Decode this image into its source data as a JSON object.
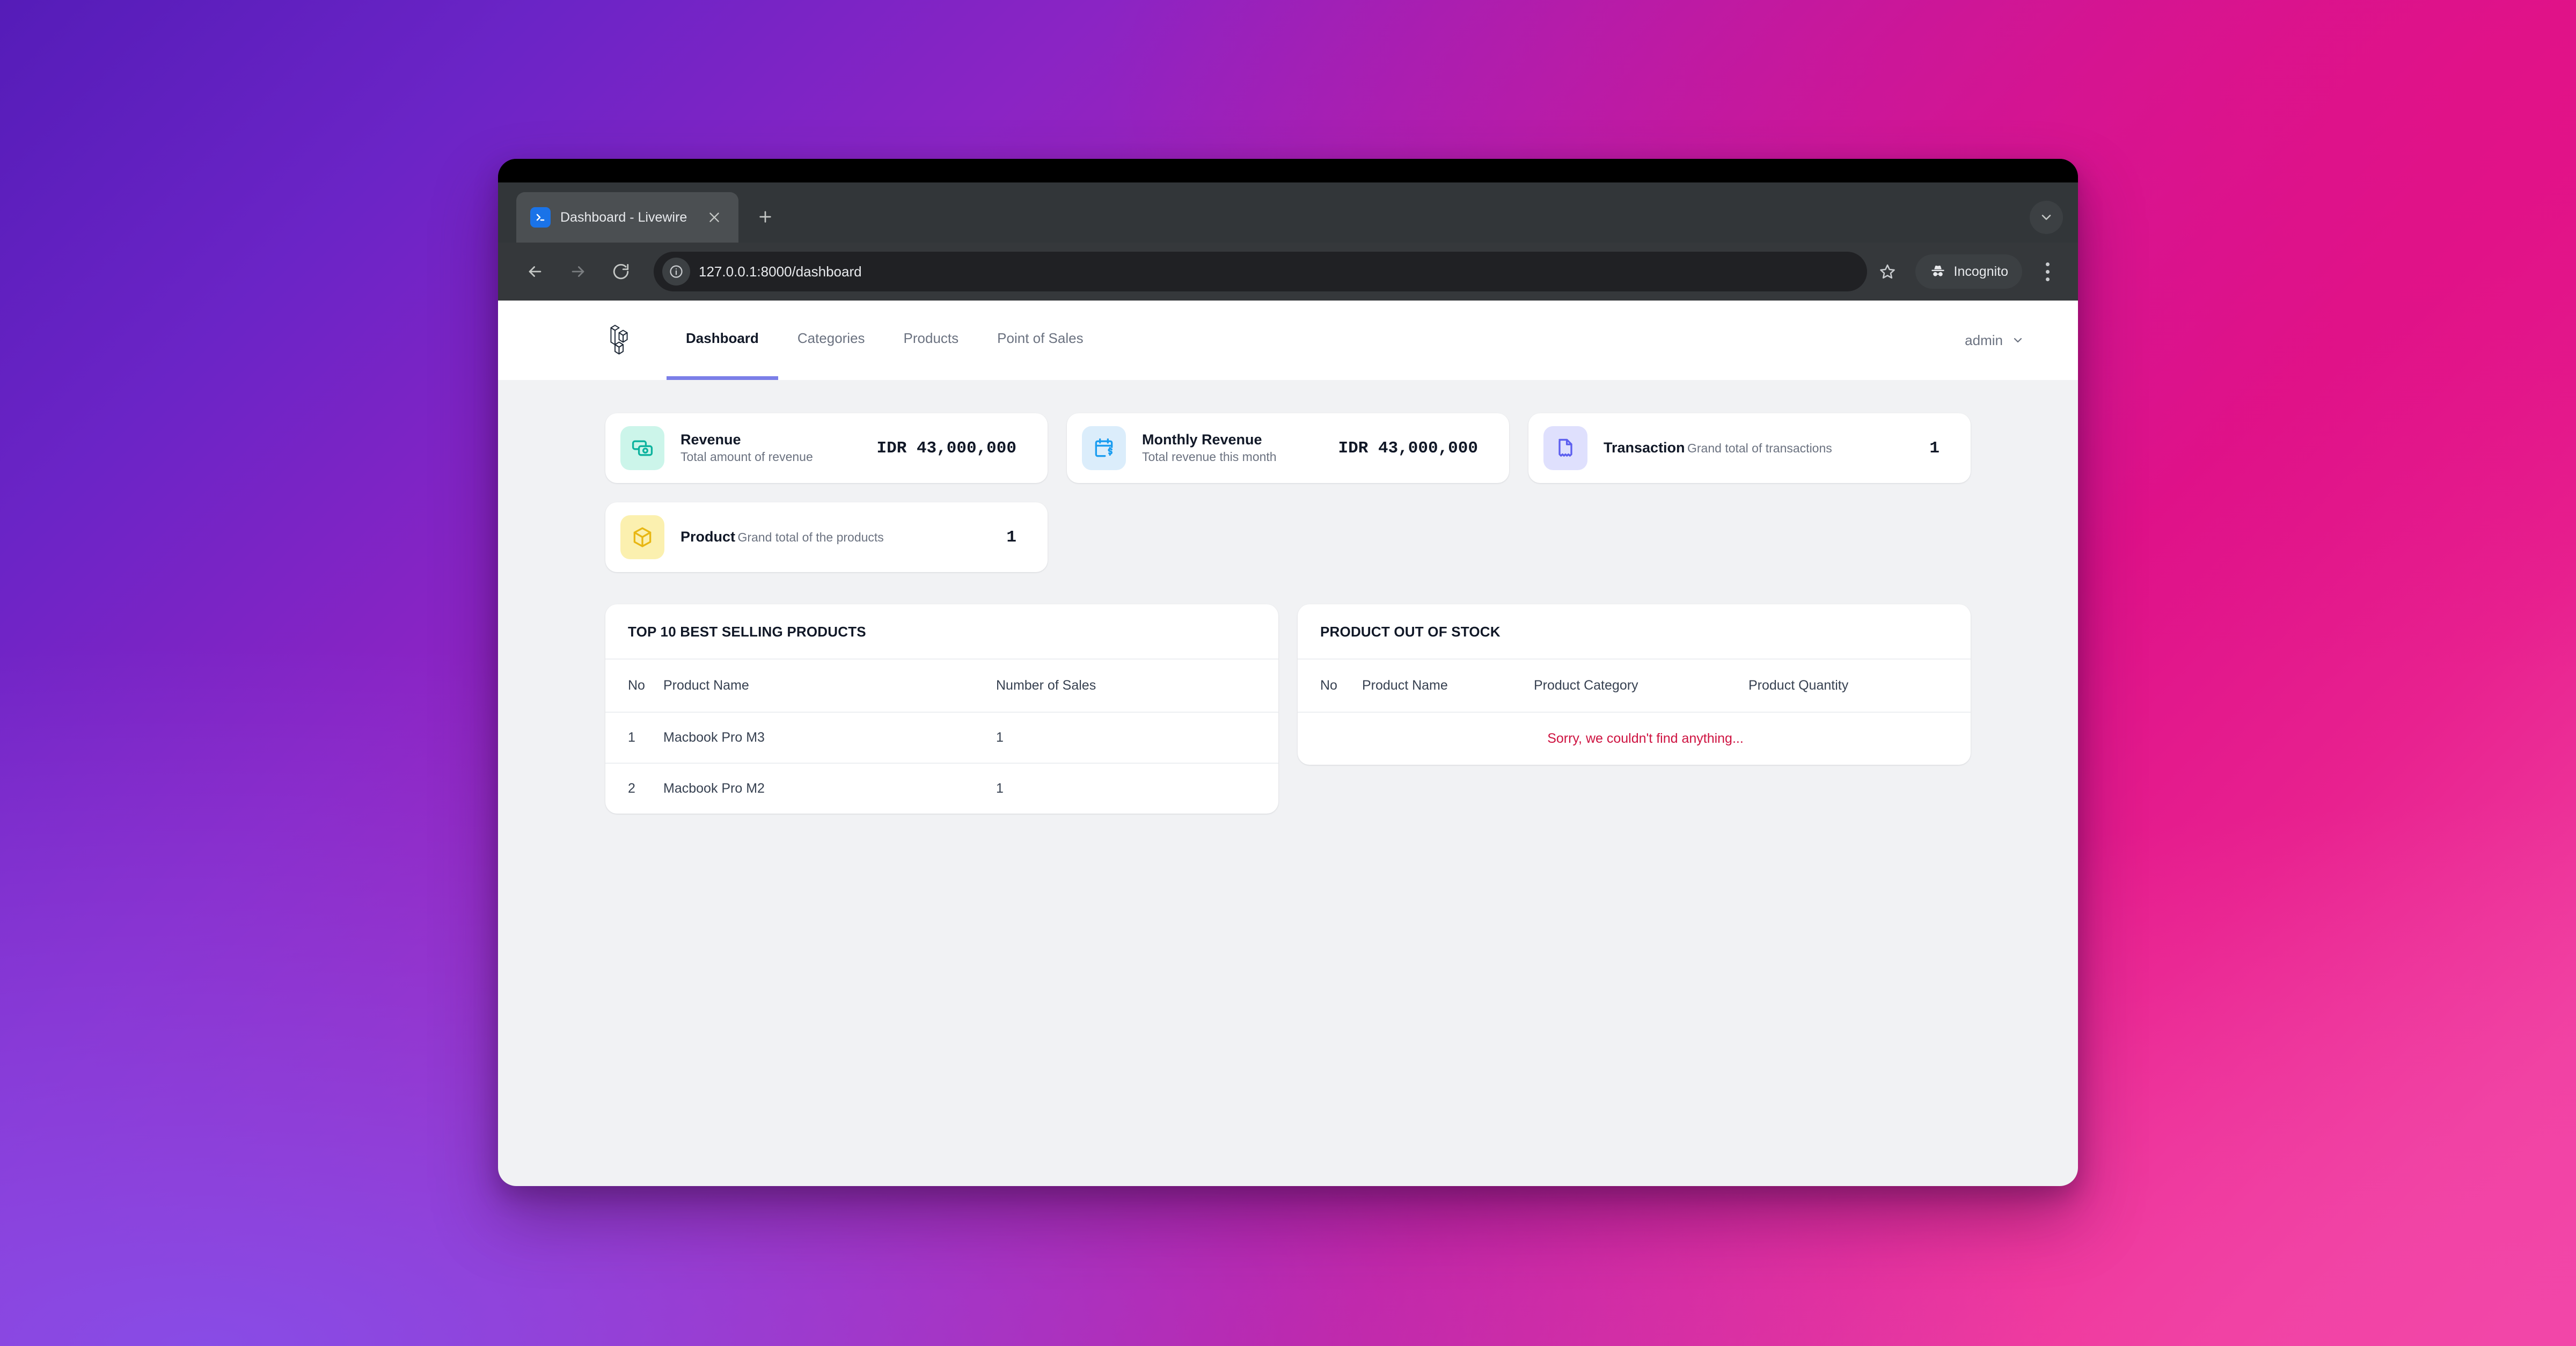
{
  "browser": {
    "tab": {
      "title": "Dashboard - Livewire",
      "favicon_name": "terminal-prompt-icon",
      "close_label": "×"
    },
    "new_tab_label": "+",
    "window_control_name": "tab-search-chevron",
    "toolbar": {
      "back_name": "back-arrow-icon",
      "forward_name": "forward-arrow-icon",
      "reload_name": "reload-icon",
      "site_info_name": "site-info-icon",
      "url": "127.0.0.1:8000/dashboard",
      "bookmark_name": "bookmark-star-icon",
      "incognito_label": "Incognito",
      "incognito_icon_name": "incognito-hat-icon",
      "menu_name": "kebab-menu-icon"
    }
  },
  "app": {
    "brand_name": "laravel-logo",
    "nav_items": [
      {
        "label": "Dashboard",
        "active": true
      },
      {
        "label": "Categories",
        "active": false
      },
      {
        "label": "Products",
        "active": false
      },
      {
        "label": "Point of Sales",
        "active": false
      }
    ],
    "user": {
      "name": "admin",
      "chevron_name": "chevron-down-icon"
    }
  },
  "stats": [
    {
      "title": "Revenue",
      "subtitle": "Total amount of revenue",
      "value": "IDR 43,000,000",
      "icon_name": "banknotes-icon",
      "icon_color": "#0DB39E",
      "icon_bg": "#CCF5EA"
    },
    {
      "title": "Monthly Revenue",
      "subtitle": "Total revenue this month",
      "value": "IDR 43,000,000",
      "icon_name": "calendar-dollar-icon",
      "icon_color": "#1B9DF0",
      "icon_bg": "#DBEDFB"
    },
    {
      "title": "Transaction",
      "subtitle": "Grand total of transactions",
      "value": "1",
      "icon_name": "receipt-icon",
      "icon_color": "#5D5FEF",
      "icon_bg": "#DFE0FD"
    },
    {
      "title": "Product",
      "subtitle": "Grand total of the products",
      "value": "1",
      "icon_name": "cube-icon",
      "icon_color": "#E8B713",
      "icon_bg": "#FBF0AF"
    }
  ],
  "panels": {
    "best_selling": {
      "title": "TOP 10 BEST SELLING PRODUCTS",
      "columns": [
        "No",
        "Product Name",
        "Number of Sales"
      ],
      "rows": [
        {
          "no": "1",
          "name": "Macbook Pro M3",
          "sales": "1"
        },
        {
          "no": "2",
          "name": "Macbook Pro M2",
          "sales": "1"
        }
      ]
    },
    "out_of_stock": {
      "title": "PRODUCT OUT OF STOCK",
      "columns": [
        "No",
        "Product Name",
        "Product Category",
        "Product Quantity"
      ],
      "rows": [],
      "empty_message": "Sorry, we couldn't find anything...",
      "empty_color": "#CE1240"
    }
  }
}
